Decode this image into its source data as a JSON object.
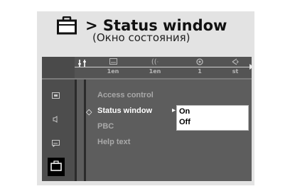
{
  "header": {
    "title": "> Status window",
    "subtitle": "(Окно состояния)"
  },
  "topbar": {
    "items": [
      {
        "icon": "subtitle-icon",
        "value": "1en"
      },
      {
        "icon": "audio-icon",
        "value": "1en"
      },
      {
        "icon": "angle-icon",
        "value": "1"
      },
      {
        "icon": "camera-icon",
        "value": "st"
      }
    ]
  },
  "sidebar": {
    "items": [
      {
        "icon": "display-icon"
      },
      {
        "icon": "speaker-icon"
      },
      {
        "icon": "subtitle-box-icon"
      },
      {
        "icon": "briefcase-icon",
        "active": true
      }
    ]
  },
  "menu": {
    "items": [
      {
        "label": "Access control"
      },
      {
        "label": "Status window",
        "selected": true
      },
      {
        "label": "PBC"
      },
      {
        "label": "Help text"
      }
    ]
  },
  "dropdown": {
    "options": [
      "On",
      "Off"
    ],
    "selected": "On"
  },
  "colors": {
    "panel": "#e3e3e3",
    "osd_background": "#5d5d5d",
    "dropdown_background": "#ffffff"
  }
}
